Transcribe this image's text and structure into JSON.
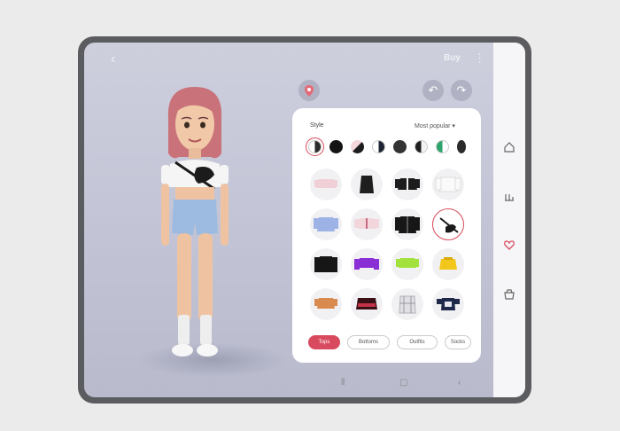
{
  "header": {
    "back_icon": "‹",
    "buy_label": "Buy",
    "menu_icon": "⋮"
  },
  "toolbar": {
    "location_icon": "pin-icon",
    "undo_icon": "↶",
    "redo_icon": "↷"
  },
  "panel": {
    "title": "Style",
    "sort_label": "Most popular ▾",
    "swatches": [
      "#2b2b2b",
      "#141414",
      "#e6bcc4",
      "#4a5a88",
      "#333",
      "#888",
      "#2ea36b",
      "#2b2b2b"
    ],
    "chips": [
      "Tops",
      "Bottoms",
      "Outfits",
      "Socks"
    ]
  },
  "sidebar": {
    "icons": [
      "home-icon",
      "shirt-icon",
      "heart-icon",
      "store-icon"
    ]
  },
  "navbar": {
    "recent": "⦀",
    "home": "▢",
    "back": "‹"
  },
  "colors": {
    "accent": "#d84a5e",
    "panel_bg": "#ffffff",
    "backdrop": "#c4c6d8"
  }
}
